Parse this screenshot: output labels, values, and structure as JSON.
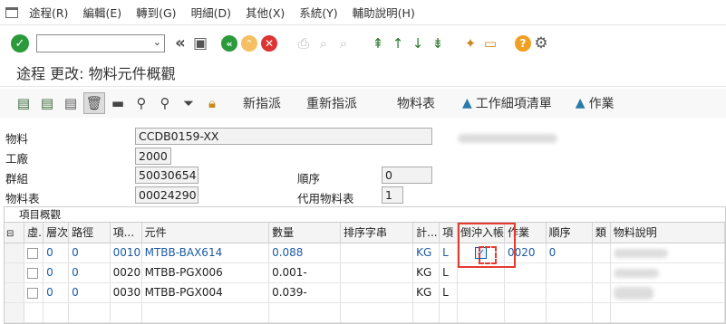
{
  "menubar": {
    "items": [
      "途程(R)",
      "編輯(E)",
      "轉到(G)",
      "明細(D)",
      "其他(X)",
      "系統(Y)",
      "輔助說明(H)"
    ]
  },
  "toolbar": {
    "command_field": ""
  },
  "page_title": "途程 更改: 物料元件概觀",
  "app_toolbar": {
    "buttons": [
      "新指派",
      "重新指派",
      "物料表",
      "工作細項清單",
      "作業"
    ]
  },
  "header": {
    "material_label": "物料",
    "material_value": "CCDB0159-XX",
    "plant_label": "工廠",
    "plant_value": "2000",
    "group_label": "群組",
    "group_value": "50030654",
    "sequence_label": "順序",
    "sequence_value": "0",
    "bom_label": "物料表",
    "bom_value": "00024290",
    "alt_bom_label": "代用物料表",
    "alt_bom_value": "1"
  },
  "grid": {
    "title": "項目概觀",
    "columns": [
      "虛.",
      "層次",
      "路徑",
      "項...",
      "元件",
      "數量",
      "排序字串",
      "計...",
      "項",
      "倒沖入帳",
      "作業",
      "順序",
      "類",
      "物料說明"
    ],
    "rows": [
      {
        "level": "0",
        "path": "0",
        "item": "0010",
        "component": "MTBB-BAX614",
        "qty": "0.088",
        "sort": "",
        "unit": "KG",
        "cat": "L",
        "backflush": "✓",
        "op": "0020",
        "seq": "0"
      },
      {
        "level": "0",
        "path": "0",
        "item": "0020",
        "component": "MTBB-PGX006",
        "qty": "0.001-",
        "sort": "",
        "unit": "KG",
        "cat": "L",
        "backflush": "",
        "op": "",
        "seq": ""
      },
      {
        "level": "0",
        "path": "0",
        "item": "0030",
        "component": "MTBB-PGX004",
        "qty": "0.039-",
        "sort": "",
        "unit": "KG",
        "cat": "L",
        "backflush": "",
        "op": "",
        "seq": ""
      }
    ]
  },
  "colors": {
    "accent_blue": "#1c5aa5",
    "highlight_red": "#e53a2e",
    "ok_green": "#2a9a3a",
    "help_orange": "#f0a020"
  }
}
